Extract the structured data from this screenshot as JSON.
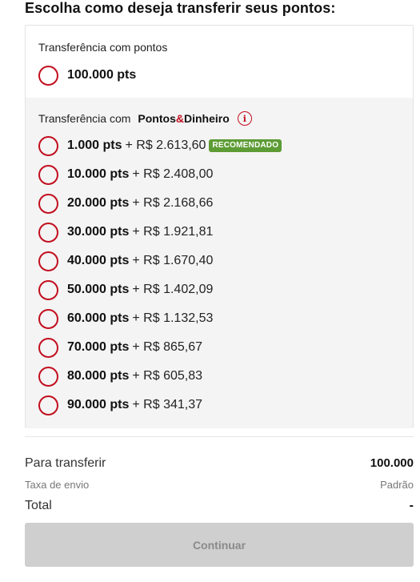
{
  "heading": "Escolha como deseja transferir seus pontos:",
  "points_section": {
    "label": "Transferência com pontos",
    "option": {
      "pts": "100.000 pts"
    }
  },
  "mix_section": {
    "label_prefix": "Transferência com",
    "brand_part1": "Pontos",
    "brand_amp": "&",
    "brand_part2": "Dinheiro",
    "info_icon_glyph": "i",
    "recommended_badge": "RECOMENDADO",
    "options": [
      {
        "pts": "1.000 pts",
        "money": "+ R$ 2.613,60",
        "recommended": true
      },
      {
        "pts": "10.000 pts",
        "money": "+ R$ 2.408,00"
      },
      {
        "pts": "20.000 pts",
        "money": "+ R$ 2.168,66"
      },
      {
        "pts": "30.000 pts",
        "money": "+ R$ 1.921,81"
      },
      {
        "pts": "40.000 pts",
        "money": "+ R$ 1.670,40"
      },
      {
        "pts": "50.000 pts",
        "money": "+ R$ 1.402,09"
      },
      {
        "pts": "60.000 pts",
        "money": "+ R$ 1.132,53"
      },
      {
        "pts": "70.000 pts",
        "money": "+ R$ 865,67"
      },
      {
        "pts": "80.000 pts",
        "money": "+ R$ 605,83"
      },
      {
        "pts": "90.000 pts",
        "money": "+ R$ 341,37"
      }
    ]
  },
  "summary": {
    "transfer_label": "Para transferir",
    "transfer_value": "100.000",
    "fee_label": "Taxa de envio",
    "fee_value": "Padrão",
    "total_label": "Total",
    "total_value": "-"
  },
  "continue_button": "Continuar",
  "colors": {
    "accent_red": "#c20f1e",
    "badge_green": "#5d9c35",
    "disabled_button": "#cfcfcf"
  }
}
